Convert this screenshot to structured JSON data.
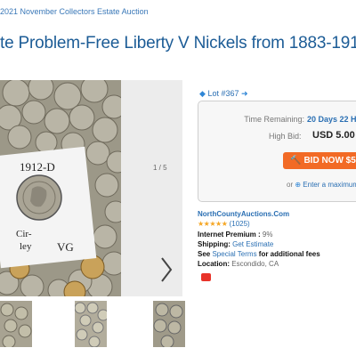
{
  "breadcrumb": "2021 November Collectors Estate Auction",
  "title": "te Problem-Free Liberty V Nickels from 1883-191",
  "gallery": {
    "counter": "1 / 5",
    "photo_card_text": [
      "1912-D",
      "Cir-",
      "ley",
      "VG"
    ]
  },
  "lot": {
    "label": "Lot #367"
  },
  "bid_box": {
    "time_remaining_label": "Time Remaining:",
    "time_remaining_value": "20 Days 22 H",
    "high_bid_label": "High Bid:",
    "high_bid_value": "USD 5.00",
    "bid_now_label": "BID NOW $5",
    "or_text": "or",
    "enter_max_label": "Enter a maximum"
  },
  "seller": {
    "name": "NorthCountyAuctions.Com",
    "stars": "★★★★★",
    "rating_count": "(1025)",
    "internet_premium_label": "Internet Premium :",
    "internet_premium_value": "9%",
    "shipping_label": "Shipping:",
    "shipping_value": "Get Estimate",
    "see_label": "See",
    "special_terms_label": "Special Terms",
    "additional_fees_label": "for additional fees",
    "location_label": "Location:",
    "location_value": "Escondido, CA"
  },
  "colors": {
    "link": "#2a6fb3",
    "title": "#1c5c96",
    "bid_button": "#f26a25",
    "stars": "#f5a623"
  }
}
